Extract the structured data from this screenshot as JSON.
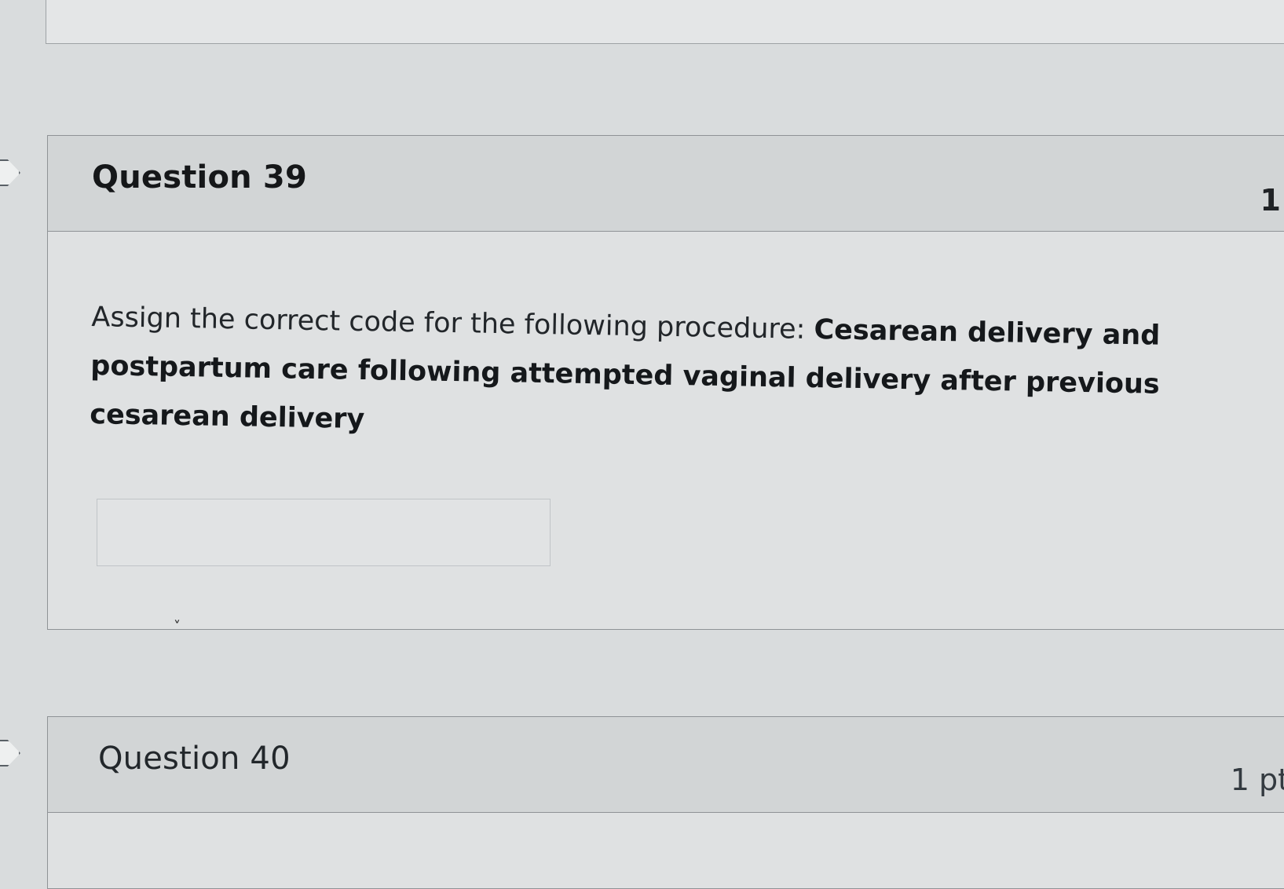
{
  "questions": [
    {
      "title": "Question 39",
      "points": "1",
      "prompt": "Assign the correct code for the following procedure:  ",
      "prompt_bold": "Cesarean delivery and postpartum care following attempted vaginal delivery after previous cesarean delivery",
      "answer_value": "",
      "stray_mark": "ˬ"
    },
    {
      "title": "Question 40",
      "points": "1 pt"
    }
  ]
}
